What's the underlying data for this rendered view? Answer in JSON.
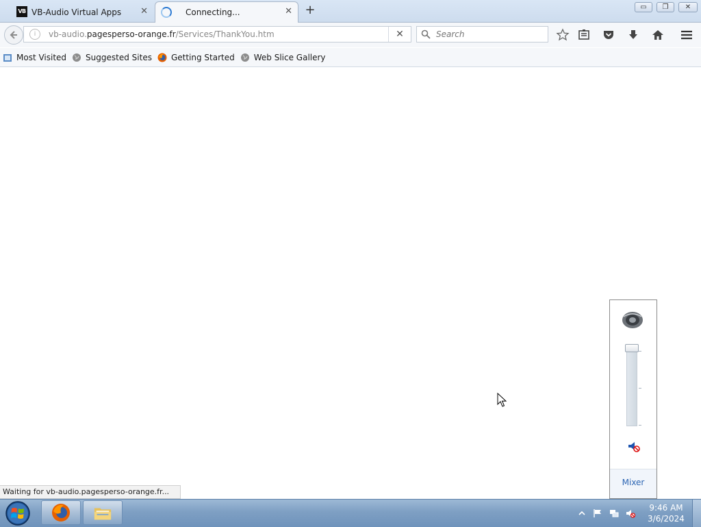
{
  "browser": {
    "tabs": [
      {
        "title": "VB-Audio Virtual Apps",
        "favicon": "vb-logo-icon",
        "active": false
      },
      {
        "title": "Connecting...",
        "favicon": "loading-spinner-icon",
        "active": true
      }
    ],
    "window_controls": {
      "minimize": "▭",
      "restore": "❐",
      "close": "✕"
    },
    "url": {
      "prefix": "vb-audio.",
      "host": "pagesperso-orange.fr",
      "path": "/Services/ThankYou.htm"
    },
    "search": {
      "placeholder": "Search"
    },
    "bookmarks": [
      {
        "label": "Most Visited",
        "icon": "bookmarks-folder-icon"
      },
      {
        "label": "Suggested Sites",
        "icon": "globe-icon"
      },
      {
        "label": "Getting Started",
        "icon": "firefox-icon"
      },
      {
        "label": "Web Slice Gallery",
        "icon": "globe-icon"
      }
    ],
    "status_text": "Waiting for vb-audio.pagesperso-orange.fr..."
  },
  "volume_flyout": {
    "level": 1.0,
    "muted": true,
    "mixer_label": "Mixer"
  },
  "taskbar": {
    "clock_time": "9:46 AM",
    "clock_date": "3/6/2024"
  },
  "colors": {
    "accent": "#2e7bd3",
    "taskbar": "#7e9fc3",
    "mixer_link": "#2c65b3"
  }
}
